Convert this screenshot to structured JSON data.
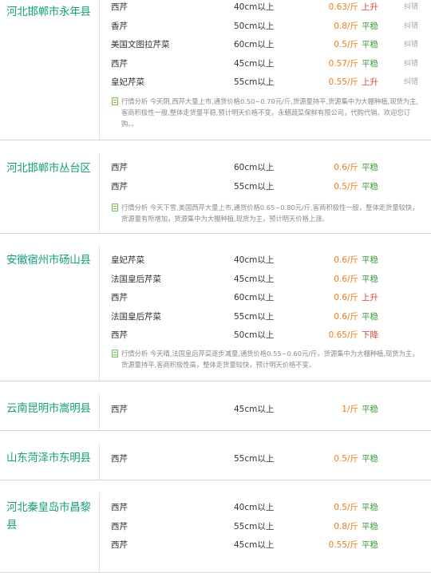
{
  "regions": [
    {
      "name": "河北邯郸市永年县",
      "rows": [
        {
          "variety": "西芹",
          "spec": "40cm以上",
          "price": "0.63/斤",
          "trend": "上升",
          "trend_type": "up",
          "correct": "纠错"
        },
        {
          "variety": "香芹",
          "spec": "50cm以上",
          "price": "0.8/斤",
          "trend": "平稳",
          "trend_type": "flat",
          "correct": "纠错"
        },
        {
          "variety": "美国文图拉芹菜",
          "spec": "60cm以上",
          "price": "0.5/斤",
          "trend": "平稳",
          "trend_type": "flat",
          "correct": "纠错"
        },
        {
          "variety": "西芹",
          "spec": "45cm以上",
          "price": "0.57/斤",
          "trend": "平稳",
          "trend_type": "flat",
          "correct": "纠错"
        },
        {
          "variety": "皇妃芹菜",
          "spec": "55cm以上",
          "price": "0.55/斤",
          "trend": "上升",
          "trend_type": "up",
          "correct": "纠错"
        }
      ],
      "analysis": "行情分析 今天阴,西芹大量上市,通货价格0.50~0.70元/斤,货源量持平,货源集中为大棚种植,现货为主,客商积极性一般,整体走货量平稳,预计明天价格不变。永朝蔬菜保鲜有限公司，代购代销。欢迎您订购。。"
    },
    {
      "name": "河北邯郸市丛台区",
      "rows": [
        {
          "variety": "西芹",
          "spec": "60cm以上",
          "price": "0.6/斤",
          "trend": "平稳",
          "trend_type": "flat",
          "correct": ""
        },
        {
          "variety": "西芹",
          "spec": "55cm以上",
          "price": "0.5/斤",
          "trend": "平稳",
          "trend_type": "flat",
          "correct": ""
        }
      ],
      "analysis": "行情分析 今天下雪,美国西芹大量上市,通货价格0.65~0.80元/斤,客商积极性一般，整体走货量较快，货源量有所增加，货源集中为大棚种植,现货为主，预计明天价格上涨。"
    },
    {
      "name": "安徽宿州市砀山县",
      "rows": [
        {
          "variety": "皇妃芹菜",
          "spec": "40cm以上",
          "price": "0.6/斤",
          "trend": "平稳",
          "trend_type": "flat",
          "correct": ""
        },
        {
          "variety": "法国皇后芹菜",
          "spec": "45cm以上",
          "price": "0.6/斤",
          "trend": "平稳",
          "trend_type": "flat",
          "correct": ""
        },
        {
          "variety": "西芹",
          "spec": "60cm以上",
          "price": "0.6/斤",
          "trend": "上升",
          "trend_type": "up",
          "correct": ""
        },
        {
          "variety": "法国皇后芹菜",
          "spec": "55cm以上",
          "price": "0.6/斤",
          "trend": "平稳",
          "trend_type": "flat",
          "correct": ""
        },
        {
          "variety": "西芹",
          "spec": "50cm以上",
          "price": "0.65/斤",
          "trend": "下降",
          "trend_type": "down",
          "correct": ""
        }
      ],
      "analysis": "行情分析 今天晴,法国皇后芹菜逐步减量,通货价格0.55~0.60元/斤。货源集中为大棚种植,现货为主，货源量持平,客商积极性高，整体走货量较快，预计明天价格不变。"
    },
    {
      "name": "云南昆明市嵩明县",
      "rows": [
        {
          "variety": "西芹",
          "spec": "45cm以上",
          "price": "1/斤",
          "trend": "平稳",
          "trend_type": "flat",
          "correct": ""
        }
      ],
      "analysis": ""
    },
    {
      "name": "山东菏泽市东明县",
      "rows": [
        {
          "variety": "西芹",
          "spec": "55cm以上",
          "price": "0.5/斤",
          "trend": "平稳",
          "trend_type": "flat",
          "correct": ""
        }
      ],
      "analysis": ""
    },
    {
      "name": "河北秦皇岛市昌黎县",
      "rows": [
        {
          "variety": "西芹",
          "spec": "40cm以上",
          "price": "0.5/斤",
          "trend": "平稳",
          "trend_type": "flat",
          "correct": ""
        },
        {
          "variety": "西芹",
          "spec": "55cm以上",
          "price": "0.8/斤",
          "trend": "平稳",
          "trend_type": "flat",
          "correct": ""
        },
        {
          "variety": "西芹",
          "spec": "45cm以上",
          "price": "0.55/斤",
          "trend": "平稳",
          "trend_type": "flat",
          "correct": ""
        }
      ],
      "analysis": ""
    }
  ]
}
